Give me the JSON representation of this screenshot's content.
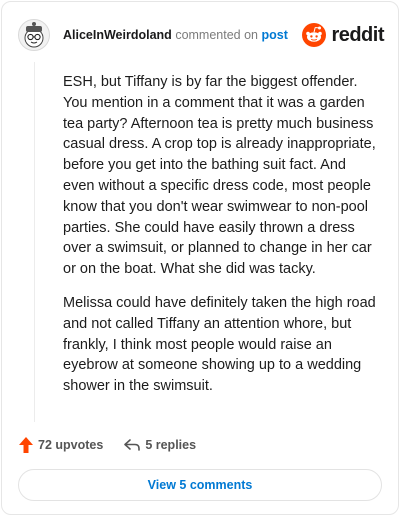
{
  "header": {
    "username": "AliceInWeirdoland",
    "action_text": "commented on",
    "target_text": "post",
    "brand_name": "reddit",
    "brand_icon": "reddit-snoo-icon",
    "avatar_icon": "snoo-avatar-icon"
  },
  "comment": {
    "paragraphs": [
      "ESH, but Tiffany is by far the biggest offender. You mention in a comment that it was a garden tea party? Afternoon tea is pretty much business casual dress. A crop top is already inappropriate, before you get into the bathing suit fact. And even without a specific dress code, most people know that you don't wear swimwear to non-pool parties. She could have easily thrown a dress over a swimsuit, or planned to change in her car or on the boat. What she did was tacky.",
      "Melissa could have definitely taken the high road and not called Tiffany an attention whore, but frankly, I think most people would raise an eyebrow at someone showing up to a wedding shower in the swimsuit."
    ]
  },
  "actions": {
    "upvotes_label": "72 upvotes",
    "upvote_icon": "upvote-arrow-icon",
    "replies_label": "5 replies",
    "reply_icon": "reply-arrow-icon"
  },
  "footer": {
    "view_comments_label": "View 5 comments"
  },
  "colors": {
    "brand_orange": "#ff4500",
    "link_blue": "#0079d3",
    "upvote_orange": "#ff4500"
  }
}
